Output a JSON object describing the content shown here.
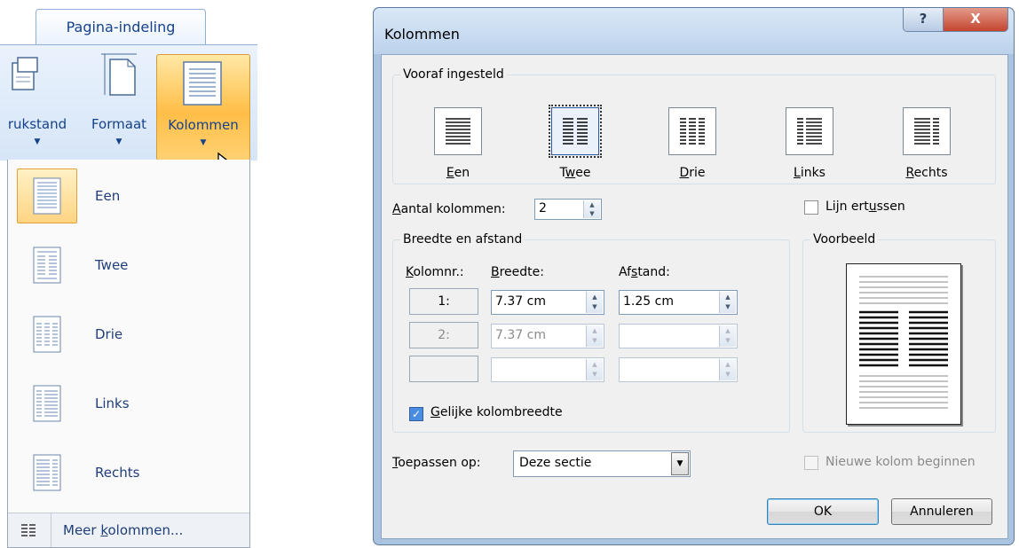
{
  "ribbon": {
    "tab_label": "Pagina-indeling",
    "buttons": [
      {
        "label": "rukstand",
        "icon": "page-orientation-icon"
      },
      {
        "label": "Formaat",
        "icon": "page-size-icon"
      },
      {
        "label": "Kolommen",
        "icon": "columns-icon"
      }
    ]
  },
  "menu": {
    "items": [
      {
        "label": "Een",
        "icon": "one-column-icon"
      },
      {
        "label": "Twee",
        "icon": "two-columns-icon"
      },
      {
        "label": "Drie",
        "icon": "three-columns-icon"
      },
      {
        "label": "Links",
        "icon": "left-column-icon"
      },
      {
        "label": "Rechts",
        "icon": "right-column-icon"
      }
    ],
    "more": {
      "label_pre": "Meer ",
      "label_u": "k",
      "label_post": "olommen...",
      "icon": "columns-icon"
    }
  },
  "dialog": {
    "title": "Kolommen",
    "help": "?",
    "close": "X",
    "presets_title": "Vooraf ingesteld",
    "presets": [
      {
        "pre": "",
        "u": "E",
        "post": "en"
      },
      {
        "pre": "T",
        "u": "w",
        "post": "ee"
      },
      {
        "pre": "",
        "u": "D",
        "post": "rie"
      },
      {
        "pre": "",
        "u": "L",
        "post": "inks"
      },
      {
        "pre": "",
        "u": "R",
        "post": "echts"
      }
    ],
    "num_columns": {
      "label_u": "A",
      "label_post": "antal kolommen:",
      "value": "2"
    },
    "line_between": {
      "pre": "Lijn ert",
      "u": "u",
      "post": "ssen",
      "checked": false
    },
    "width_spacing": {
      "title": "Breedte en afstand",
      "col_header_u": "K",
      "col_header_post": "olomnr.:",
      "width_header_u": "B",
      "width_header_post": "reedte:",
      "spacing_header_pre": "Af",
      "spacing_header_u": "s",
      "spacing_header_post": "tand:",
      "rows": [
        {
          "nr": "1:",
          "width": "7.37 cm",
          "spacing": "1.25 cm"
        },
        {
          "nr": "2:",
          "width": "7.37 cm",
          "spacing": ""
        },
        {
          "nr": "",
          "width": "",
          "spacing": ""
        }
      ],
      "equal": {
        "u": "G",
        "post": "elijke kolombreedte",
        "checked": true
      }
    },
    "preview_title": "Voorbeeld",
    "apply": {
      "label_u": "T",
      "label_post": "oepassen op:",
      "value": "Deze sectie"
    },
    "new_column": {
      "label": "Nieuwe kolom beginnen",
      "checked": false
    },
    "ok": "OK",
    "cancel": "Annuleren"
  }
}
